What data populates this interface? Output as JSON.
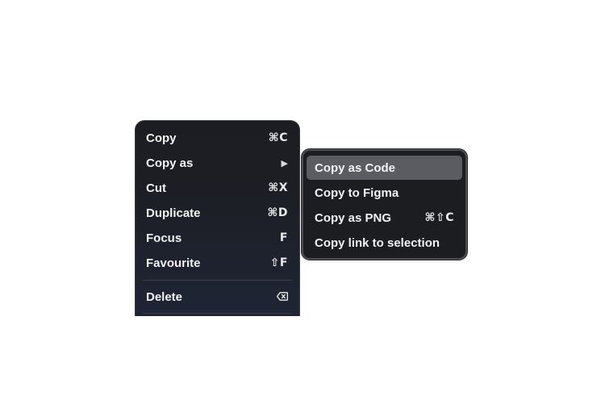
{
  "context_menu": {
    "items": [
      {
        "label": "Copy",
        "shortcut": "⌘C"
      },
      {
        "label": "Copy as",
        "indicator": "▶"
      },
      {
        "label": "Cut",
        "shortcut": "⌘X"
      },
      {
        "label": "Duplicate",
        "shortcut": "⌘D"
      },
      {
        "label": "Focus",
        "shortcut": "F"
      },
      {
        "label": "Favourite",
        "shortcut": "⇧F"
      },
      {
        "label": "Delete",
        "icon": "delete-backspace-icon"
      }
    ]
  },
  "submenu": {
    "items": [
      {
        "label": "Copy as Code",
        "highlighted": true
      },
      {
        "label": "Copy to Figma"
      },
      {
        "label": "Copy as PNG",
        "shortcut": "⌘⇧C"
      },
      {
        "label": "Copy link to selection"
      }
    ]
  },
  "colors": {
    "menu_background": "#1c1d21",
    "highlight": "#5a5c61",
    "text": "#f2f2f3",
    "page_background": "#ffffff"
  }
}
